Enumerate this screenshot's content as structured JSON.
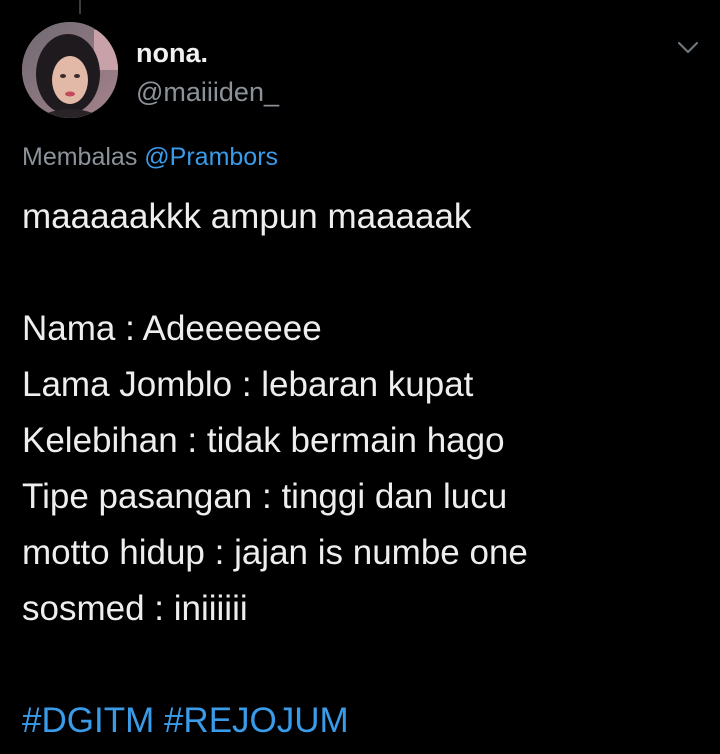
{
  "user": {
    "display_name": "nona.",
    "handle": "@maiiiden_",
    "avatar_icon": "user-avatar-photo"
  },
  "menu": {
    "icon": "chevron-down-icon"
  },
  "reply": {
    "prefix": "Membalas",
    "mention": "@Prambors"
  },
  "tweet": {
    "lines": [
      "maaaaakkk ampun maaaaak",
      "",
      "Nama : Adeeeeeee",
      "Lama Jomblo : lebaran kupat",
      "Kelebihan : tidak bermain hago",
      "Tipe pasangan : tinggi dan lucu",
      "motto hidup : jajan is numbe one",
      "sosmed : iniiiiii",
      ""
    ],
    "hashtags": [
      "#DGITM",
      "#REJOJUM"
    ]
  },
  "colors": {
    "background": "#000000",
    "text": "#eeeeee",
    "secondary": "#8b9299",
    "link": "#3a9be8"
  }
}
